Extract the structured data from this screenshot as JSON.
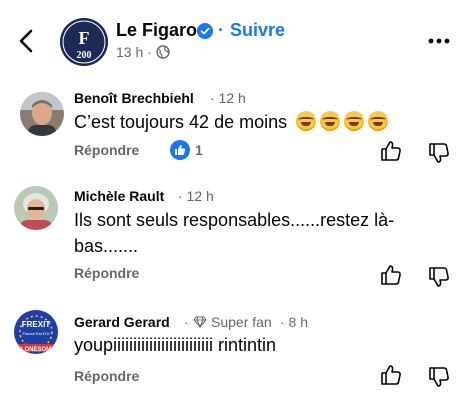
{
  "header": {
    "title": "Le Figaro",
    "separator": "·",
    "follow_label": "Suivre",
    "time": "13 h ·",
    "logo_text": "200"
  },
  "comments": [
    {
      "author": "Benoît Brechbiehl",
      "time": "· 12 h",
      "text": "C’est toujours 42 de moins",
      "emoji_count": 4,
      "reply_label": "Répondre",
      "reaction_count": "1"
    },
    {
      "author": "Michèle Rault",
      "time": "· 12 h",
      "text_line1": "Ils sont seuls responsables......restez là-",
      "text_line2": "bas.......",
      "reply_label": "Répondre"
    },
    {
      "author": "Gerard Gerard",
      "badge_prefix": "·",
      "badge": "Super fan",
      "time": "· 8 h",
      "text": "youpiiiiiiiiiiiiiiiiiiiiiiiii rintintin",
      "reply_label": "Répondre",
      "avatar_text_top": "FREXIT",
      "avatar_text_mid": "France Est D'U",
      "avatar_text_bottom": "LONESOME"
    }
  ],
  "colors": {
    "accent": "#1877f2",
    "muted": "#65676b",
    "text": "#050505"
  }
}
